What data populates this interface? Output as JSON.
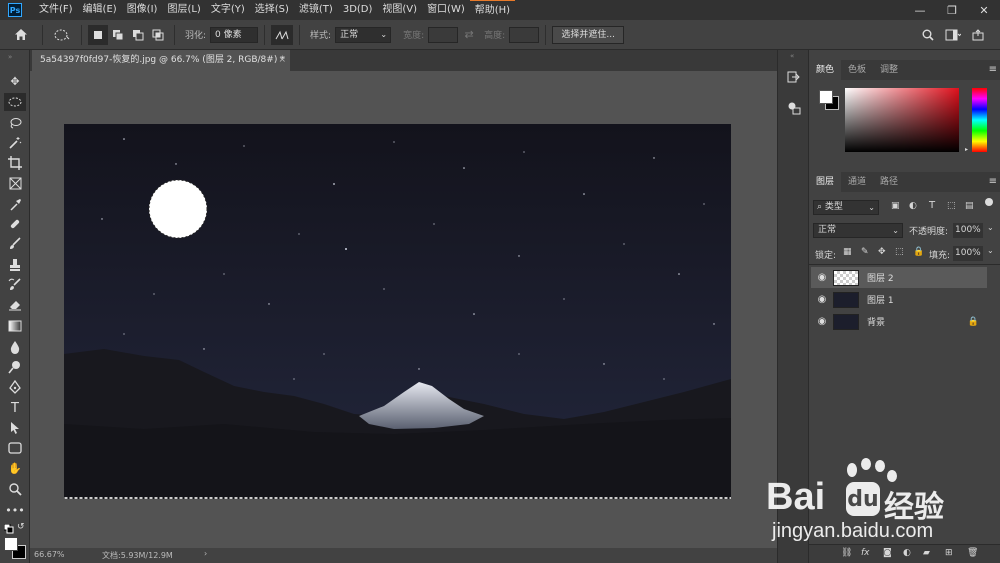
{
  "app": {
    "logo": "Ps"
  },
  "menu": [
    "文件(F)",
    "编辑(E)",
    "图像(I)",
    "图层(L)",
    "文字(Y)",
    "选择(S)",
    "滤镜(T)",
    "3D(D)",
    "视图(V)",
    "窗口(W)",
    "帮助(H)"
  ],
  "window_controls": {
    "minimize": "—",
    "restore": "❐",
    "close": "✕"
  },
  "options": {
    "feather_label": "羽化:",
    "feather_value": "0 像素",
    "style_label": "样式:",
    "style_value": "正常",
    "width_label": "宽度:",
    "height_label": "高度:",
    "select_mask_button": "选择并遮住..."
  },
  "document": {
    "tab_title": "5a54397f0fd97-恢复的.jpg @ 66.7% (图层 2, RGB/8#) *",
    "close": "×"
  },
  "status": {
    "zoom": "66.67%",
    "doc_info": "文档:5.93M/12.9M",
    "arrow": "›"
  },
  "color_panel": {
    "tabs": [
      "颜色",
      "色板",
      "调整"
    ],
    "active": 0
  },
  "layers_panel": {
    "tabs": [
      "图层",
      "通道",
      "路径"
    ],
    "active": 0,
    "filter_kind": "类型",
    "blend_mode": "正常",
    "opacity_label": "不透明度:",
    "opacity_value": "100%",
    "lock_label": "锁定:",
    "fill_label": "填充:",
    "fill_value": "100%",
    "layers": [
      {
        "name": "图层 2",
        "selected": true,
        "visible": true
      },
      {
        "name": "图层 1",
        "selected": false,
        "visible": true
      },
      {
        "name": "背景",
        "selected": false,
        "visible": true,
        "locked": true
      }
    ]
  },
  "watermark": {
    "brand": "Bai",
    "brand_cn": "经验",
    "url": "jingyan.baidu.com"
  },
  "colors": {
    "foreground": "#ffffff",
    "background": "#000000",
    "accent": "#31a8ff"
  }
}
